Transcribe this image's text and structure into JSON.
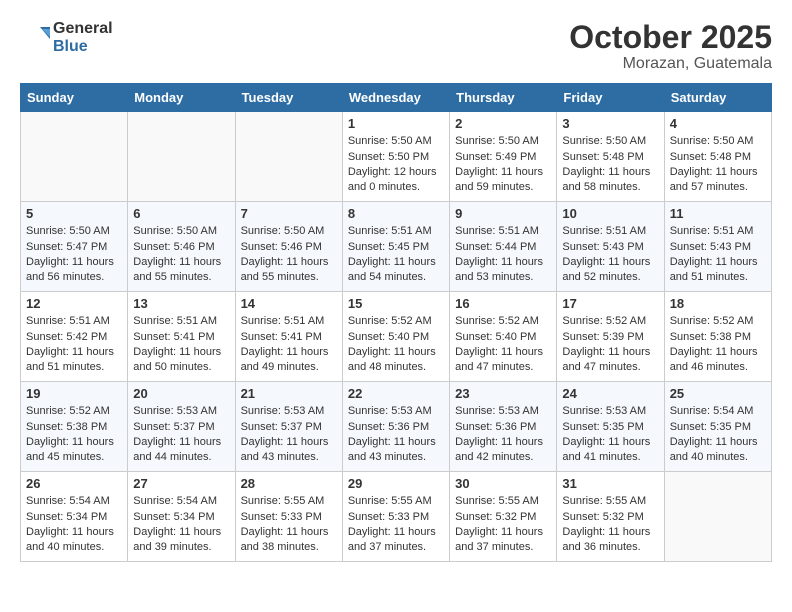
{
  "logo": {
    "line1": "General",
    "line2": "Blue"
  },
  "title": "October 2025",
  "location": "Morazan, Guatemala",
  "days_of_week": [
    "Sunday",
    "Monday",
    "Tuesday",
    "Wednesday",
    "Thursday",
    "Friday",
    "Saturday"
  ],
  "weeks": [
    [
      {
        "day": "",
        "info": ""
      },
      {
        "day": "",
        "info": ""
      },
      {
        "day": "",
        "info": ""
      },
      {
        "day": "1",
        "sunrise": "5:50 AM",
        "sunset": "5:50 PM",
        "daylight": "12 hours and 0 minutes."
      },
      {
        "day": "2",
        "sunrise": "5:50 AM",
        "sunset": "5:49 PM",
        "daylight": "11 hours and 59 minutes."
      },
      {
        "day": "3",
        "sunrise": "5:50 AM",
        "sunset": "5:48 PM",
        "daylight": "11 hours and 58 minutes."
      },
      {
        "day": "4",
        "sunrise": "5:50 AM",
        "sunset": "5:48 PM",
        "daylight": "11 hours and 57 minutes."
      }
    ],
    [
      {
        "day": "5",
        "sunrise": "5:50 AM",
        "sunset": "5:47 PM",
        "daylight": "11 hours and 56 minutes."
      },
      {
        "day": "6",
        "sunrise": "5:50 AM",
        "sunset": "5:46 PM",
        "daylight": "11 hours and 55 minutes."
      },
      {
        "day": "7",
        "sunrise": "5:50 AM",
        "sunset": "5:46 PM",
        "daylight": "11 hours and 55 minutes."
      },
      {
        "day": "8",
        "sunrise": "5:51 AM",
        "sunset": "5:45 PM",
        "daylight": "11 hours and 54 minutes."
      },
      {
        "day": "9",
        "sunrise": "5:51 AM",
        "sunset": "5:44 PM",
        "daylight": "11 hours and 53 minutes."
      },
      {
        "day": "10",
        "sunrise": "5:51 AM",
        "sunset": "5:43 PM",
        "daylight": "11 hours and 52 minutes."
      },
      {
        "day": "11",
        "sunrise": "5:51 AM",
        "sunset": "5:43 PM",
        "daylight": "11 hours and 51 minutes."
      }
    ],
    [
      {
        "day": "12",
        "sunrise": "5:51 AM",
        "sunset": "5:42 PM",
        "daylight": "11 hours and 51 minutes."
      },
      {
        "day": "13",
        "sunrise": "5:51 AM",
        "sunset": "5:41 PM",
        "daylight": "11 hours and 50 minutes."
      },
      {
        "day": "14",
        "sunrise": "5:51 AM",
        "sunset": "5:41 PM",
        "daylight": "11 hours and 49 minutes."
      },
      {
        "day": "15",
        "sunrise": "5:52 AM",
        "sunset": "5:40 PM",
        "daylight": "11 hours and 48 minutes."
      },
      {
        "day": "16",
        "sunrise": "5:52 AM",
        "sunset": "5:40 PM",
        "daylight": "11 hours and 47 minutes."
      },
      {
        "day": "17",
        "sunrise": "5:52 AM",
        "sunset": "5:39 PM",
        "daylight": "11 hours and 47 minutes."
      },
      {
        "day": "18",
        "sunrise": "5:52 AM",
        "sunset": "5:38 PM",
        "daylight": "11 hours and 46 minutes."
      }
    ],
    [
      {
        "day": "19",
        "sunrise": "5:52 AM",
        "sunset": "5:38 PM",
        "daylight": "11 hours and 45 minutes."
      },
      {
        "day": "20",
        "sunrise": "5:53 AM",
        "sunset": "5:37 PM",
        "daylight": "11 hours and 44 minutes."
      },
      {
        "day": "21",
        "sunrise": "5:53 AM",
        "sunset": "5:37 PM",
        "daylight": "11 hours and 43 minutes."
      },
      {
        "day": "22",
        "sunrise": "5:53 AM",
        "sunset": "5:36 PM",
        "daylight": "11 hours and 43 minutes."
      },
      {
        "day": "23",
        "sunrise": "5:53 AM",
        "sunset": "5:36 PM",
        "daylight": "11 hours and 42 minutes."
      },
      {
        "day": "24",
        "sunrise": "5:53 AM",
        "sunset": "5:35 PM",
        "daylight": "11 hours and 41 minutes."
      },
      {
        "day": "25",
        "sunrise": "5:54 AM",
        "sunset": "5:35 PM",
        "daylight": "11 hours and 40 minutes."
      }
    ],
    [
      {
        "day": "26",
        "sunrise": "5:54 AM",
        "sunset": "5:34 PM",
        "daylight": "11 hours and 40 minutes."
      },
      {
        "day": "27",
        "sunrise": "5:54 AM",
        "sunset": "5:34 PM",
        "daylight": "11 hours and 39 minutes."
      },
      {
        "day": "28",
        "sunrise": "5:55 AM",
        "sunset": "5:33 PM",
        "daylight": "11 hours and 38 minutes."
      },
      {
        "day": "29",
        "sunrise": "5:55 AM",
        "sunset": "5:33 PM",
        "daylight": "11 hours and 37 minutes."
      },
      {
        "day": "30",
        "sunrise": "5:55 AM",
        "sunset": "5:32 PM",
        "daylight": "11 hours and 37 minutes."
      },
      {
        "day": "31",
        "sunrise": "5:55 AM",
        "sunset": "5:32 PM",
        "daylight": "11 hours and 36 minutes."
      },
      {
        "day": "",
        "info": ""
      }
    ]
  ]
}
